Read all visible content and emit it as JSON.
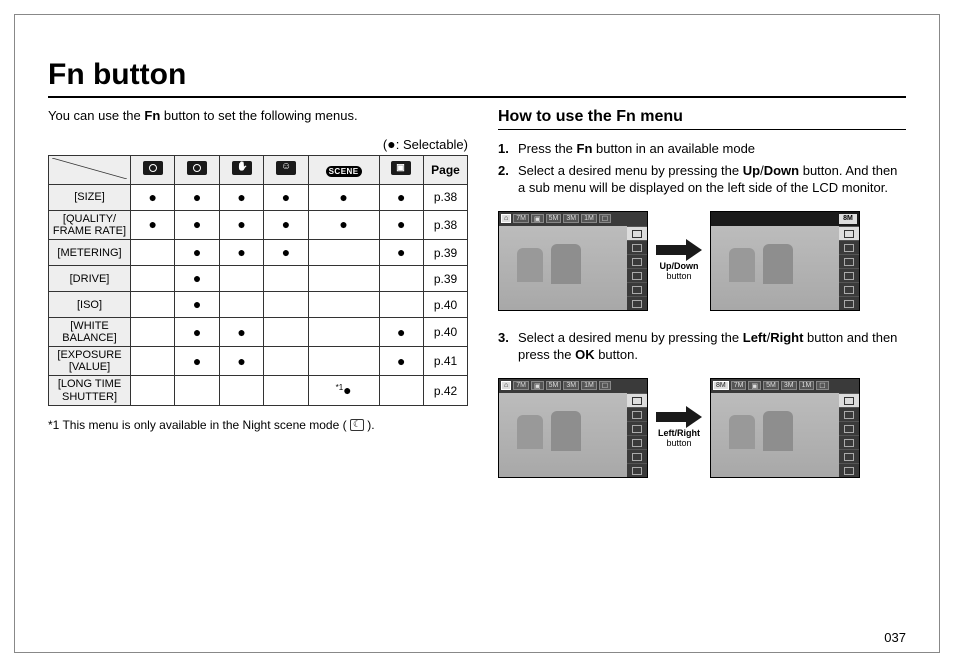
{
  "title": "Fn button",
  "intro_pre": "You can use the ",
  "intro_bold": "Fn",
  "intro_post": " button to set the following menus.",
  "legend_pre": "(",
  "legend_dot": "●",
  "legend_post": ": Selectable)",
  "table": {
    "page_header": "Page",
    "modes": [
      "auto",
      "program",
      "dis",
      "beauty",
      "scene",
      "movie"
    ],
    "rows": [
      {
        "label": "[SIZE]",
        "sel": [
          true,
          true,
          true,
          true,
          true,
          true
        ],
        "page": "p.38",
        "note": ""
      },
      {
        "label": "[QUALITY/\nFRAME RATE]",
        "sel": [
          true,
          true,
          true,
          true,
          true,
          true
        ],
        "page": "p.38",
        "note": ""
      },
      {
        "label": "[METERING]",
        "sel": [
          false,
          true,
          true,
          true,
          false,
          true
        ],
        "page": "p.39",
        "note": ""
      },
      {
        "label": "[DRIVE]",
        "sel": [
          false,
          true,
          false,
          false,
          false,
          false
        ],
        "page": "p.39",
        "note": ""
      },
      {
        "label": "[ISO]",
        "sel": [
          false,
          true,
          false,
          false,
          false,
          false
        ],
        "page": "p.40",
        "note": ""
      },
      {
        "label": "[WHITE\nBALANCE]",
        "sel": [
          false,
          true,
          true,
          false,
          false,
          true
        ],
        "page": "p.40",
        "note": ""
      },
      {
        "label": "[EXPOSURE\n[VALUE]",
        "sel": [
          false,
          true,
          true,
          false,
          false,
          true
        ],
        "page": "p.41",
        "note": ""
      },
      {
        "label": "[LONG TIME\nSHUTTER]",
        "sel": [
          false,
          false,
          false,
          false,
          true,
          false
        ],
        "page": "p.42",
        "note": "*1"
      }
    ]
  },
  "footnote": {
    "mark": "*1",
    "text": " This menu is only available in the Night scene mode ( ",
    "post": " )."
  },
  "section_title": "How to use the Fn menu",
  "steps1": [
    {
      "n": "1.",
      "pre": "Press the ",
      "b1": "Fn",
      "post": " button in an available mode"
    },
    {
      "n": "2.",
      "pre": "Select a desired menu by pressing the ",
      "b1": "Up",
      "sep": "/",
      "b2": "Down",
      "post": " button. And then a sub menu will be displayed on the left side of the LCD monitor."
    }
  ],
  "steps2": [
    {
      "n": "3.",
      "pre": "Select a desired menu by pressing the ",
      "b1": "Left",
      "sep": "/",
      "b2": "Right",
      "mid": " button and then press the ",
      "b3": "OK",
      "post": " button."
    }
  ],
  "arrow1": {
    "line1a": "Up",
    "line1sep": "/",
    "line1b": "Down",
    "line2": "button"
  },
  "arrow2": {
    "line1a": "Left",
    "line1sep": "/",
    "line1b": "Right",
    "line2": "button"
  },
  "lcd_top_items": [
    "⌂",
    "7M",
    "▣",
    "5M",
    "3M",
    "1M",
    "☐"
  ],
  "lcd_corner": "8M",
  "page_number": "037"
}
